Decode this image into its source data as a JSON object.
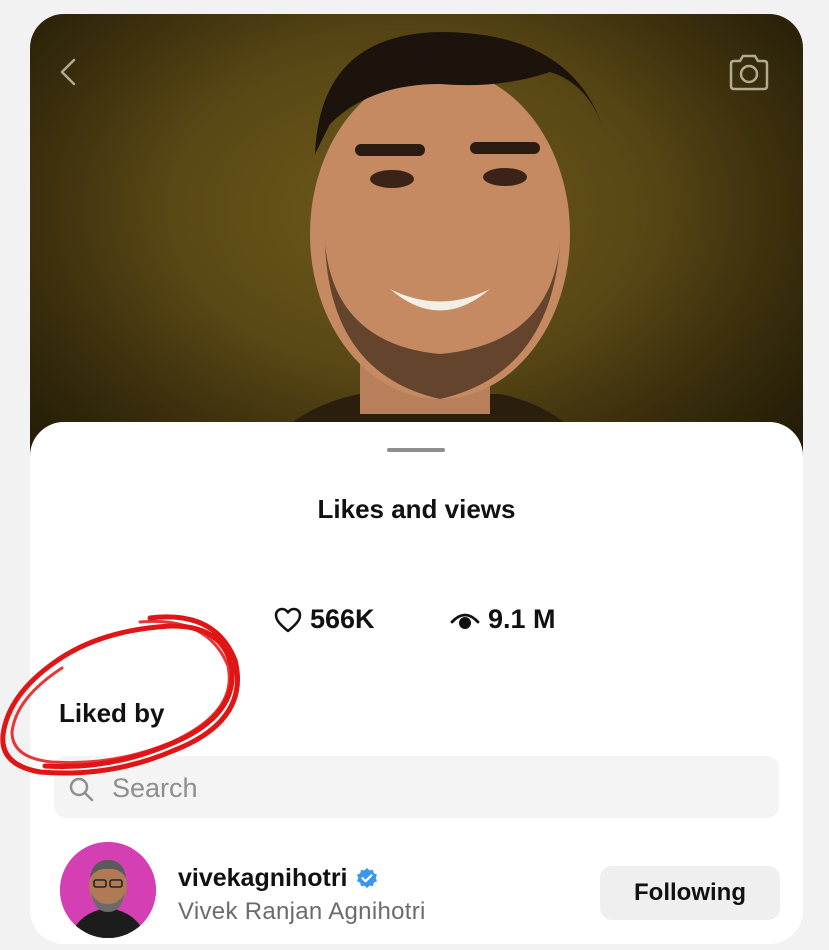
{
  "post": {
    "video_description": "",
    "icons": {
      "back": "chevron-left-icon",
      "camera": "camera-icon"
    }
  },
  "sheet": {
    "title": "Likes and views",
    "likes": {
      "icon": "heart-outline-icon",
      "count": "566K"
    },
    "views": {
      "icon": "eye-icon",
      "count": "9.1 M"
    },
    "liked_by_label": "Liked by",
    "search": {
      "placeholder": "Search",
      "icon": "search-icon"
    },
    "users": [
      {
        "username": "vivekagnihotri",
        "full_name": "Vivek Ranjan Agnihotri",
        "verified": true,
        "button_label": "Following"
      }
    ]
  },
  "colors": {
    "verified_badge": "#3897f0",
    "annotation_circle": "#e01515",
    "avatar_background": "#d43fb3"
  }
}
